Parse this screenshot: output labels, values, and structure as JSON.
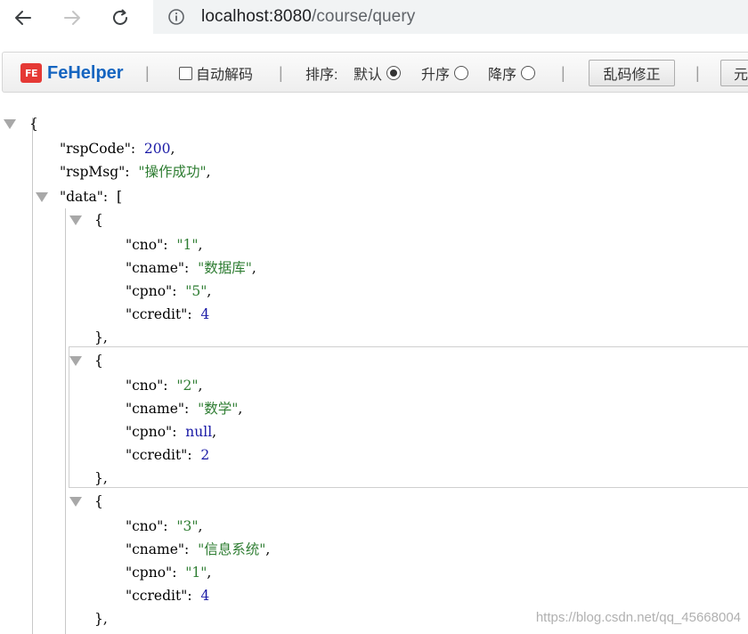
{
  "browser": {
    "url_host": "localhost:8080",
    "url_path": "/course/query"
  },
  "toolbar": {
    "brand": "FeHelper",
    "brand_mark": "FE",
    "auto_decode_label": "自动解码",
    "auto_decode_checked": false,
    "sort_label": "排序:",
    "sort_options": [
      {
        "label": "默认",
        "checked": true
      },
      {
        "label": "升序",
        "checked": false
      },
      {
        "label": "降序",
        "checked": false
      }
    ],
    "fix_encoding_label": "乱码修正",
    "more_label": "元",
    "separator": "|"
  },
  "json": {
    "rsp_code_key": "\"rspCode\"",
    "rsp_code_value": "200",
    "rsp_msg_key": "\"rspMsg\"",
    "rsp_msg_value": "\"操作成功\"",
    "data_key": "\"data\"",
    "items": [
      {
        "cno": "\"1\"",
        "cname": "\"数据库\"",
        "cpno": "\"5\"",
        "ccredit": "4"
      },
      {
        "cno": "\"2\"",
        "cname": "\"数学\"",
        "cpno": "null",
        "ccredit": "2"
      },
      {
        "cno": "\"3\"",
        "cname": "\"信息系统\"",
        "cpno": "\"1\"",
        "ccredit": "4"
      }
    ],
    "field_keys": {
      "cno": "\"cno\"",
      "cname": "\"cname\"",
      "cpno": "\"cpno\"",
      "ccredit": "\"ccredit\""
    }
  },
  "watermark": "https://blog.csdn.net/qq_45668004"
}
